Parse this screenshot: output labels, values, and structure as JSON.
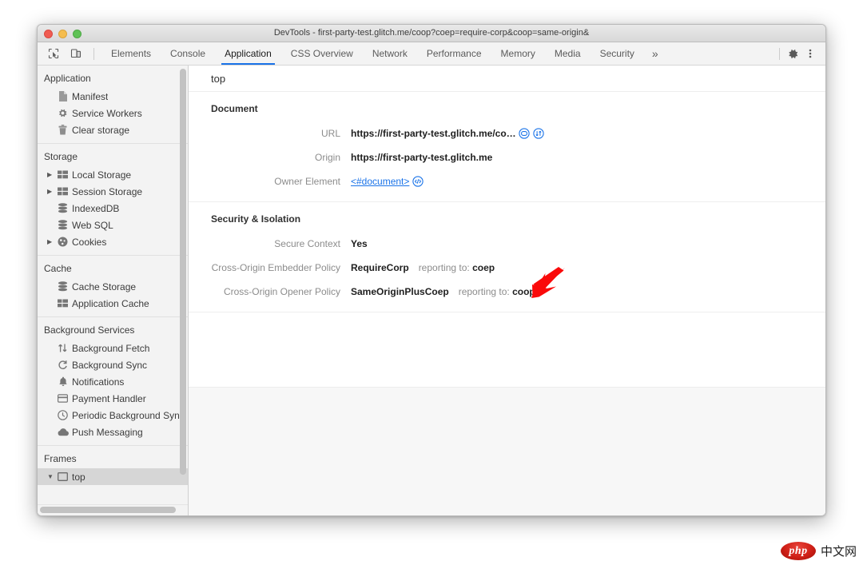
{
  "window": {
    "title": "DevTools - first-party-test.glitch.me/coop?coep=require-corp&coop=same-origin&"
  },
  "toolbar": {
    "inspect_icon": "inspect-element-icon",
    "device_icon": "device-toolbar-icon",
    "overflow_label": "»",
    "settings_icon": "gear-icon",
    "more_icon": "more-vertical-icon",
    "tabs": [
      {
        "label": "Elements",
        "active": false
      },
      {
        "label": "Console",
        "active": false
      },
      {
        "label": "Application",
        "active": true
      },
      {
        "label": "CSS Overview",
        "active": false
      },
      {
        "label": "Network",
        "active": false
      },
      {
        "label": "Performance",
        "active": false
      },
      {
        "label": "Memory",
        "active": false
      },
      {
        "label": "Media",
        "active": false
      },
      {
        "label": "Security",
        "active": false
      }
    ]
  },
  "sidebar": {
    "groups": [
      {
        "title": "Application",
        "items": [
          {
            "label": "Manifest",
            "icon": "document-icon",
            "expandable": false,
            "selected": false
          },
          {
            "label": "Service Workers",
            "icon": "gear-icon",
            "expandable": false,
            "selected": false
          },
          {
            "label": "Clear storage",
            "icon": "trash-icon",
            "expandable": false,
            "selected": false
          }
        ]
      },
      {
        "title": "Storage",
        "items": [
          {
            "label": "Local Storage",
            "icon": "table-icon",
            "expandable": true,
            "selected": false
          },
          {
            "label": "Session Storage",
            "icon": "table-icon",
            "expandable": true,
            "selected": false
          },
          {
            "label": "IndexedDB",
            "icon": "database-icon",
            "expandable": false,
            "selected": false
          },
          {
            "label": "Web SQL",
            "icon": "database-icon",
            "expandable": false,
            "selected": false
          },
          {
            "label": "Cookies",
            "icon": "cookie-icon",
            "expandable": true,
            "selected": false
          }
        ]
      },
      {
        "title": "Cache",
        "items": [
          {
            "label": "Cache Storage",
            "icon": "database-icon",
            "expandable": false,
            "selected": false
          },
          {
            "label": "Application Cache",
            "icon": "table-icon",
            "expandable": false,
            "selected": false
          }
        ]
      },
      {
        "title": "Background Services",
        "items": [
          {
            "label": "Background Fetch",
            "icon": "arrows-updown-icon",
            "expandable": false,
            "selected": false
          },
          {
            "label": "Background Sync",
            "icon": "sync-icon",
            "expandable": false,
            "selected": false
          },
          {
            "label": "Notifications",
            "icon": "bell-icon",
            "expandable": false,
            "selected": false
          },
          {
            "label": "Payment Handler",
            "icon": "credit-card-icon",
            "expandable": false,
            "selected": false
          },
          {
            "label": "Periodic Background Syn",
            "icon": "clock-icon",
            "expandable": false,
            "selected": false
          },
          {
            "label": "Push Messaging",
            "icon": "cloud-icon",
            "expandable": false,
            "selected": false
          }
        ]
      },
      {
        "title": "Frames",
        "items": [
          {
            "label": "top",
            "icon": "frame-icon",
            "expandable": true,
            "selected": true
          }
        ]
      }
    ]
  },
  "main": {
    "frame_name": "top",
    "sections": [
      {
        "title": "Document",
        "rows": [
          {
            "label": "URL",
            "value": "https://first-party-test.glitch.me/co…",
            "bold": true,
            "link": false,
            "icons": [
              "reveal-in-elements-icon",
              "open-in-network-icon"
            ],
            "reporting": null
          },
          {
            "label": "Origin",
            "value": "https://first-party-test.glitch.me",
            "bold": true,
            "link": false,
            "icons": [],
            "reporting": null
          },
          {
            "label": "Owner Element",
            "value": "<#document>",
            "bold": false,
            "link": true,
            "icons": [
              "code-icon"
            ],
            "reporting": null
          }
        ]
      },
      {
        "title": "Security & Isolation",
        "rows": [
          {
            "label": "Secure Context",
            "value": "Yes",
            "bold": true,
            "link": false,
            "icons": [],
            "reporting": null
          },
          {
            "label": "Cross-Origin Embedder Policy",
            "value": "RequireCorp",
            "bold": true,
            "link": false,
            "icons": [],
            "reporting": {
              "prefix": "reporting to:",
              "endpoint": "coep"
            }
          },
          {
            "label": "Cross-Origin Opener Policy",
            "value": "SameOriginPlusCoep",
            "bold": true,
            "link": false,
            "icons": [],
            "reporting": {
              "prefix": "reporting to:",
              "endpoint": "coop"
            }
          }
        ]
      }
    ]
  },
  "annotation": {
    "arrow_icon": "red-arrow-down-left-icon",
    "color": "#fa0a0a"
  },
  "watermark": {
    "logo_text": "php",
    "text": "中文网"
  },
  "colors": {
    "accent": "#1a73e8",
    "link": "#1a73e8",
    "sidebar_bg": "#f3f3f3",
    "selected_bg": "#d6d6d6",
    "text": "#303030",
    "muted_text": "#8c8c8c"
  }
}
